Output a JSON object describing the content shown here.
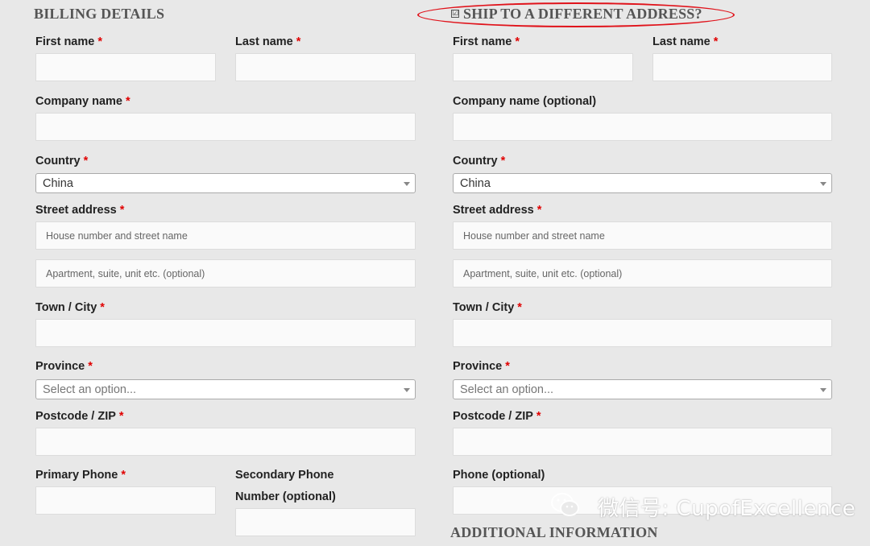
{
  "billing": {
    "title": "BILLING DETAILS",
    "first_name_label": "First name",
    "last_name_label": "Last name",
    "company_label": "Company name",
    "country_label": "Country",
    "country_value": "China",
    "street_label": "Street address",
    "street_placeholder": "House number and street name",
    "apartment_placeholder": "Apartment, suite, unit etc. (optional)",
    "city_label": "Town / City",
    "province_label": "Province",
    "province_placeholder": "Select an option...",
    "postcode_label": "Postcode / ZIP",
    "primary_phone_label": "Primary Phone",
    "secondary_phone_label_line1": "Secondary Phone",
    "secondary_phone_label_line2": "Number (optional)"
  },
  "shipping": {
    "title": "SHIP TO A DIFFERENT ADDRESS?",
    "checked": true,
    "checkbox_glyph": "☑",
    "first_name_label": "First name",
    "last_name_label": "Last name",
    "company_label": "Company name (optional)",
    "country_label": "Country",
    "country_value": "China",
    "street_label": "Street address",
    "street_placeholder": "House number and street name",
    "apartment_placeholder": "Apartment, suite, unit etc. (optional)",
    "city_label": "Town / City",
    "province_label": "Province",
    "province_placeholder": "Select an option...",
    "postcode_label": "Postcode / ZIP",
    "phone_label": "Phone (optional)"
  },
  "additional": {
    "title": "ADDITIONAL INFORMATION"
  },
  "required_marker": "*",
  "watermark": {
    "text": "微信号: CupofExcellence",
    "icon": "wechat-icon"
  },
  "colors": {
    "required": "#e00000",
    "highlight_ellipse": "#e0131b",
    "background": "#e8e8e8"
  }
}
